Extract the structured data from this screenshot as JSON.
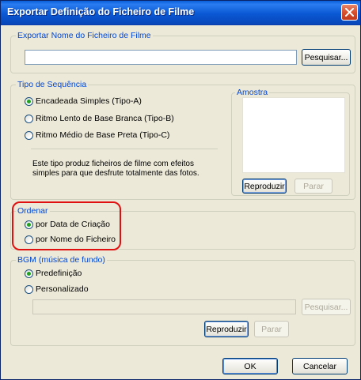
{
  "window": {
    "title": "Exportar Definição do Ficheiro de Filme"
  },
  "export_name": {
    "legend": "Exportar Nome do Ficheiro de Filme",
    "value": "",
    "browse_label": "Pesquisar..."
  },
  "sequence": {
    "legend": "Tipo de Sequência",
    "options": [
      {
        "label": "Encadeada Simples (Tipo-A)",
        "checked": true
      },
      {
        "label": "Ritmo Lento de Base Branca (Tipo-B)",
        "checked": false
      },
      {
        "label": "Ritmo Médio de Base Preta (Tipo-C)",
        "checked": false
      }
    ],
    "description_line1": "Este tipo produz ficheiros de filme com efeitos",
    "description_line2": "simples para que desfrute totalmente das fotos.",
    "preview": {
      "legend": "Amostra",
      "play_label": "Reproduzir",
      "stop_label": "Parar"
    }
  },
  "order": {
    "legend": "Ordenar",
    "options": [
      {
        "label": "por Data de Criação",
        "checked": true
      },
      {
        "label": "por Nome do Ficheiro",
        "checked": false
      }
    ],
    "highlight_color": "#e01010"
  },
  "bgm": {
    "legend": "BGM (música de fundo)",
    "options": [
      {
        "label": "Predefinição",
        "checked": true
      },
      {
        "label": "Personalizado",
        "checked": false
      }
    ],
    "custom_path": "",
    "browse_label": "Pesquisar...",
    "play_label": "Reproduzir",
    "stop_label": "Parar"
  },
  "footer": {
    "ok_label": "OK",
    "cancel_label": "Cancelar"
  },
  "colors": {
    "titlebar": "#0a58d4",
    "legend": "#0046d5",
    "dialog_bg": "#ece9d8",
    "radio_check": "#21a121"
  }
}
